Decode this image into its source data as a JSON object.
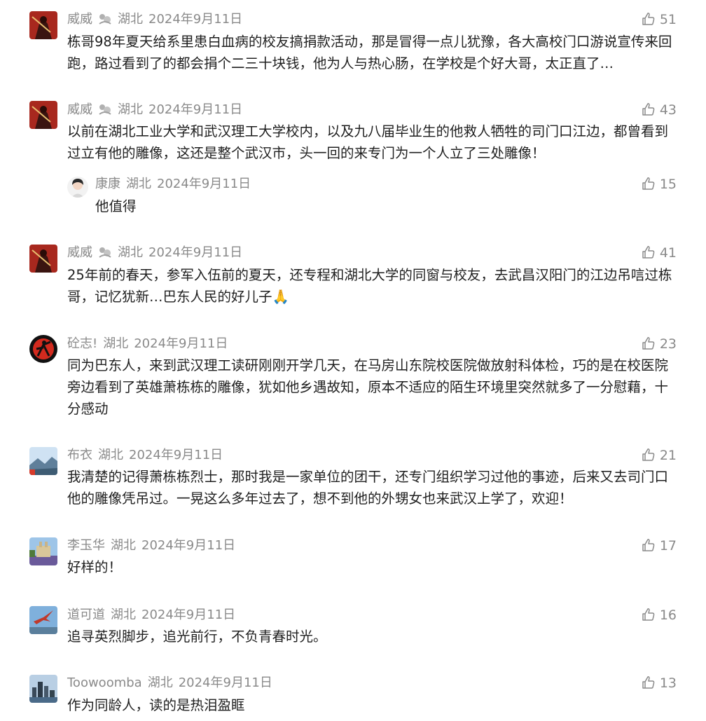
{
  "comments": [
    {
      "author": "威威",
      "location": "湖北",
      "date": "2024年9月11日",
      "likes": "51",
      "text": "栋哥98年夏天给系里患白血病的校友搞捐款活动，那是冒得一点儿犹豫，各大高校门口游说宣传来回跑，路过看到了的都会捐个二三十块钱，他为人与热心肠，在学校是个好大哥，太正直了…",
      "avatar_icon": "warrior-avatar-icon"
    },
    {
      "author": "威威",
      "location": "湖北",
      "date": "2024年9月11日",
      "likes": "43",
      "text": "以前在湖北工业大学和武汉理工大学校内，以及九八届毕业生的他救人牺牲的司门口江边，都曾看到过立有他的雕像，这还是整个武汉市，头一回的来专门为一个人立了三处雕像！",
      "avatar_icon": "warrior-avatar-icon"
    },
    {
      "author": "康康",
      "location": "湖北",
      "date": "2024年9月11日",
      "likes": "15",
      "text": "他值得",
      "avatar_icon": "girl-avatar-icon"
    },
    {
      "author": "威威",
      "location": "湖北",
      "date": "2024年9月11日",
      "likes": "41",
      "text": "25年前的春天，参军入伍前的夏天，还专程和湖北大学的同窗与校友，去武昌汉阳门的江边吊唁过栋哥，记忆犹新…巴东人民的好儿子🙏",
      "avatar_icon": "warrior-avatar-icon"
    },
    {
      "author": "砼志!",
      "location": "湖北",
      "date": "2024年9月11日",
      "likes": "23",
      "text": "同为巴东人，来到武汉理工读研刚刚开学几天，在马房山东院校医院做放射科体检，巧的是在校医院旁边看到了英雄萧栋栋的雕像，犹如他乡遇故知，原本不适应的陌生环境里突然就多了一分慰藉，十分感动",
      "avatar_icon": "martial-arts-avatar-icon"
    },
    {
      "author": "布衣",
      "location": "湖北",
      "date": "2024年9月11日",
      "likes": "21",
      "text": "我清楚的记得萧栋栋烈士，那时我是一家单位的团干，还专门组织学习过他的事迹，后来又去司门口他的雕像凭吊过。一晃这么多年过去了，想不到他的外甥女也来武汉上学了，欢迎！",
      "avatar_icon": "landscape-avatar-icon"
    },
    {
      "author": "李玉华",
      "location": "湖北",
      "date": "2024年9月11日",
      "likes": "17",
      "text": "好样的！",
      "avatar_icon": "castle-avatar-icon"
    },
    {
      "author": "道可道",
      "location": "湖北",
      "date": "2024年9月11日",
      "likes": "16",
      "text": "追寻英烈脚步，追光前行，不负青春时光。",
      "avatar_icon": "bird-avatar-icon"
    },
    {
      "author": "Toowoomba",
      "location": "湖北",
      "date": "2024年9月11日",
      "likes": "13",
      "text": "作为同龄人，读的是热泪盈眶",
      "avatar_icon": "city-avatar-icon"
    }
  ]
}
